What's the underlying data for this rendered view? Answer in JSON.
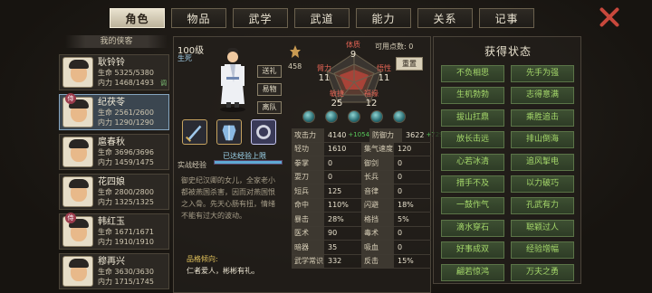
{
  "tabs": [
    {
      "label": "角色",
      "active": true
    },
    {
      "label": "物品"
    },
    {
      "label": "武学"
    },
    {
      "label": "武道"
    },
    {
      "label": "能力"
    },
    {
      "label": "关系"
    },
    {
      "label": "记事"
    }
  ],
  "list_header": "我的侠客",
  "heroes": [
    {
      "name": "耿铃铃",
      "hp": "生命 5325/5380",
      "mp": "内力 1468/1493",
      "tag": "调",
      "badge": ""
    },
    {
      "name": "纪茯苓",
      "hp": "生命 2561/2600",
      "mp": "内力 1290/1290",
      "tag": "",
      "badge": "侍",
      "selected": true
    },
    {
      "name": "扈春秋",
      "hp": "生命 3696/3696",
      "mp": "内力 1459/1475",
      "tag": "",
      "badge": ""
    },
    {
      "name": "花四娘",
      "hp": "生命 2800/2800",
      "mp": "内力 1325/1325",
      "tag": "",
      "badge": ""
    },
    {
      "name": "韩红玉",
      "hp": "生命 1671/1671",
      "mp": "内力 1910/1910",
      "tag": "",
      "badge": "侍"
    },
    {
      "name": "穆再兴",
      "hp": "生命 3630/3630",
      "mp": "内力 1715/1745",
      "tag": "",
      "badge": ""
    }
  ],
  "char": {
    "level": "100级",
    "state": "生死",
    "buttons": [
      "送礼",
      "易物",
      "离队"
    ],
    "exp_label": "实战经验",
    "exp_text": "已达经验上限",
    "exp_fraction": 1.0,
    "bio": "御史纪汉卿的女儿，全家老小都被燕国杀害，因而对燕国恨之入骨。先天心肠有扭，情绪不能有过大的波动。",
    "trait_header": "品格倾向:",
    "trait_value": "仁者爱人，彬彬有礼。"
  },
  "potential": {
    "value": "458"
  },
  "attrs": {
    "tizhi": {
      "k": "体质",
      "v": "9"
    },
    "biili": {
      "k": "臂力",
      "v": "11"
    },
    "wuxing": {
      "k": "悟性",
      "v": "11"
    },
    "minjie": {
      "k": "敏捷",
      "v": "25"
    },
    "fuyuan": {
      "k": "福缘",
      "v": "12"
    }
  },
  "points": "可用点数: 0",
  "reset": "重置",
  "stats": [
    [
      {
        "k": "攻击力",
        "v": "4140",
        "plus": "+1054"
      },
      {
        "k": "防御力",
        "v": "3622",
        "plus": "+729"
      }
    ],
    [
      {
        "k": "轻功",
        "v": "1610"
      },
      {
        "k": "集气速度",
        "v": "120"
      }
    ],
    [
      {
        "k": "拳掌",
        "v": "0"
      },
      {
        "k": "御剑",
        "v": "0"
      }
    ],
    [
      {
        "k": "耍刀",
        "v": "0"
      },
      {
        "k": "长兵",
        "v": "0"
      }
    ],
    [
      {
        "k": "短兵",
        "v": "125"
      },
      {
        "k": "音律",
        "v": "0"
      }
    ],
    [
      {
        "k": "命中",
        "v": "110%"
      },
      {
        "k": "闪避",
        "v": "18%"
      }
    ],
    [
      {
        "k": "暴击",
        "v": "28%"
      },
      {
        "k": "格挡",
        "v": "5%"
      }
    ],
    [
      {
        "k": "医术",
        "v": "90"
      },
      {
        "k": "毒术",
        "v": "0"
      }
    ],
    [
      {
        "k": "暗器",
        "v": "35"
      },
      {
        "k": "吸血",
        "v": "0"
      }
    ],
    [
      {
        "k": "武学常识",
        "v": "332"
      },
      {
        "k": "反击",
        "v": "15%"
      }
    ]
  ],
  "status_title": "获得状态",
  "status": [
    "不负相思",
    "先手为强",
    "生机勃勃",
    "志得意满",
    "拔山扛鼎",
    "乘胜追击",
    "放长击远",
    "排山倒海",
    "心若冰清",
    "追风掣电",
    "措手不及",
    "以力破巧",
    "一鼓作气",
    "孔武有力",
    "滴水穿石",
    "聪颖过人",
    "好事成双",
    "经验增幅",
    "翩若惊鸿",
    "万夫之勇"
  ]
}
